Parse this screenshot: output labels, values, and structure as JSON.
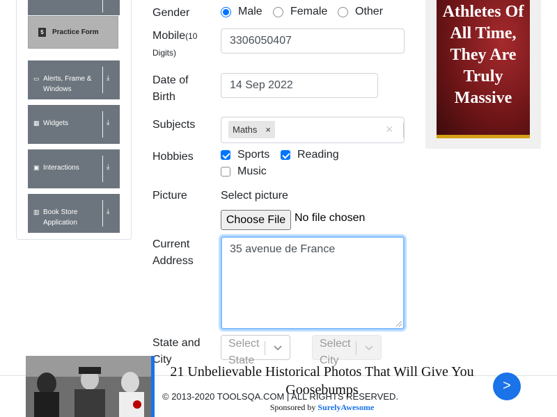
{
  "sidebar": {
    "practice_form": "Practice Form",
    "groups": [
      {
        "label": "Alerts, Frame & Windows",
        "icon": "window-icon"
      },
      {
        "label": "Widgets",
        "icon": "widgets-icon"
      },
      {
        "label": "Interactions",
        "icon": "interactions-icon"
      },
      {
        "label": "Book Store Application",
        "icon": "book-icon"
      }
    ]
  },
  "form": {
    "gender": {
      "label": "Gender",
      "options": [
        "Male",
        "Female",
        "Other"
      ],
      "selected": "Male"
    },
    "mobile": {
      "label": "Mobile",
      "hint": "(10 Digits)",
      "value": "3306050407"
    },
    "dob": {
      "label": "Date of Birth",
      "value": "14 Sep 2022"
    },
    "subjects": {
      "label": "Subjects",
      "tags": [
        "Maths"
      ]
    },
    "hobbies": {
      "label": "Hobbies",
      "options": [
        {
          "label": "Sports",
          "checked": true
        },
        {
          "label": "Reading",
          "checked": true
        },
        {
          "label": "Music",
          "checked": false
        }
      ]
    },
    "picture": {
      "label": "Picture",
      "prompt": "Select picture",
      "button": "Choose File",
      "status": "No file chosen"
    },
    "address": {
      "label": "Current Address",
      "value": "35 avenue de France"
    },
    "state_city": {
      "label": "State and City",
      "state_placeholder": "Select State",
      "city_placeholder": "Select City"
    }
  },
  "ad_right": {
    "text": "Athletes Of All Time, They Are Truly Massive",
    "accent": "#d4a017"
  },
  "footer": {
    "copyright": "© 2013-2020 TOOLSQA.COM | ALL RIGHTS RESERVED."
  },
  "ad_bottom": {
    "title": "21 Unbelievable Historical Photos That Will Give You Goosebumps",
    "sponsored_prefix": "Sponsored by",
    "sponsor": "SurelyAwesome",
    "next": ">",
    "accent": "#1a73e8"
  }
}
